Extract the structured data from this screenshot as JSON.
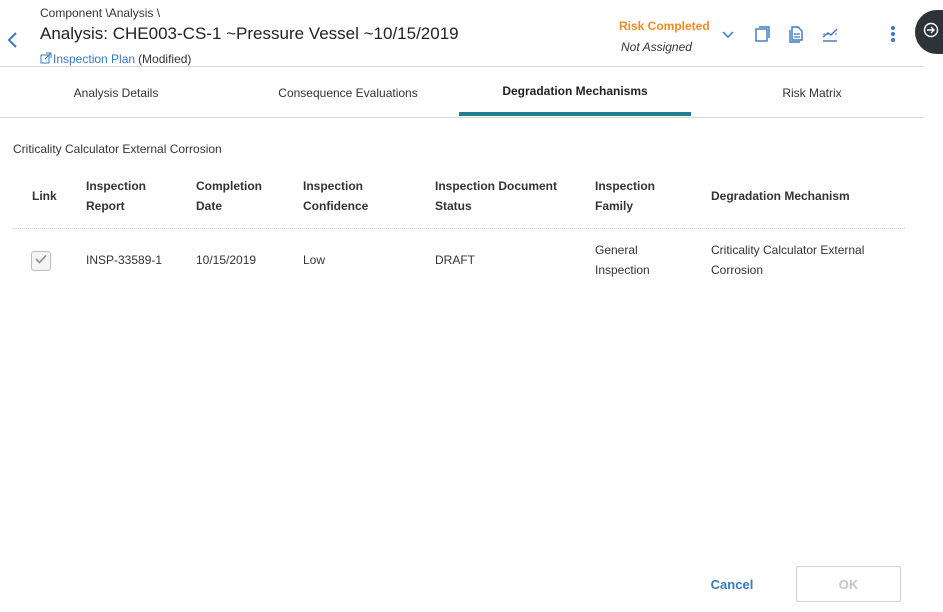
{
  "header": {
    "breadcrumb": "Component \\Analysis \\",
    "title": "Analysis: CHE003-CS-1 ~Pressure Vessel ~10/15/2019",
    "inspection_plan_link": "Inspection Plan",
    "modified_label": "(Modified)",
    "risk_status": "Risk Completed",
    "assignment_status": "Not Assigned",
    "icons": [
      "chevron-left-icon",
      "external-link-icon",
      "chevron-down-icon",
      "copy-icon",
      "document-icon",
      "graph-icon",
      "more-vertical-icon",
      "exit-icon"
    ]
  },
  "tabs": [
    {
      "label": "Analysis Details",
      "active": false
    },
    {
      "label": "Consequence Evaluations",
      "active": false
    },
    {
      "label": "Degradation Mechanisms",
      "active": true
    },
    {
      "label": "Risk Matrix",
      "active": false
    }
  ],
  "section": {
    "title": "Criticality Calculator External Corrosion"
  },
  "table": {
    "columns": [
      {
        "line1": "Link",
        "line2": ""
      },
      {
        "line1": "Inspection",
        "line2": "Report"
      },
      {
        "line1": "Completion",
        "line2": "Date"
      },
      {
        "line1": "Inspection",
        "line2": "Confidence"
      },
      {
        "line1": "Inspection Document",
        "line2": "Status"
      },
      {
        "line1": "Inspection",
        "line2": "Family"
      },
      {
        "line1": "Degradation Mechanism",
        "line2": ""
      }
    ],
    "rows": [
      {
        "linked": true,
        "report": "INSP-33589-1",
        "completion_date": "10/15/2019",
        "confidence": "Low",
        "document_status": "DRAFT",
        "family_line1": "General",
        "family_line2": "Inspection",
        "mechanism_line1": "Criticality Calculator External",
        "mechanism_line2": "Corrosion"
      }
    ]
  },
  "footer": {
    "cancel_label": "Cancel",
    "ok_label": "OK"
  },
  "colors": {
    "accent": "#1e7f8e",
    "link": "#3a78c3",
    "risk_status": "#f08a24",
    "side_panel": "#2d3339"
  }
}
